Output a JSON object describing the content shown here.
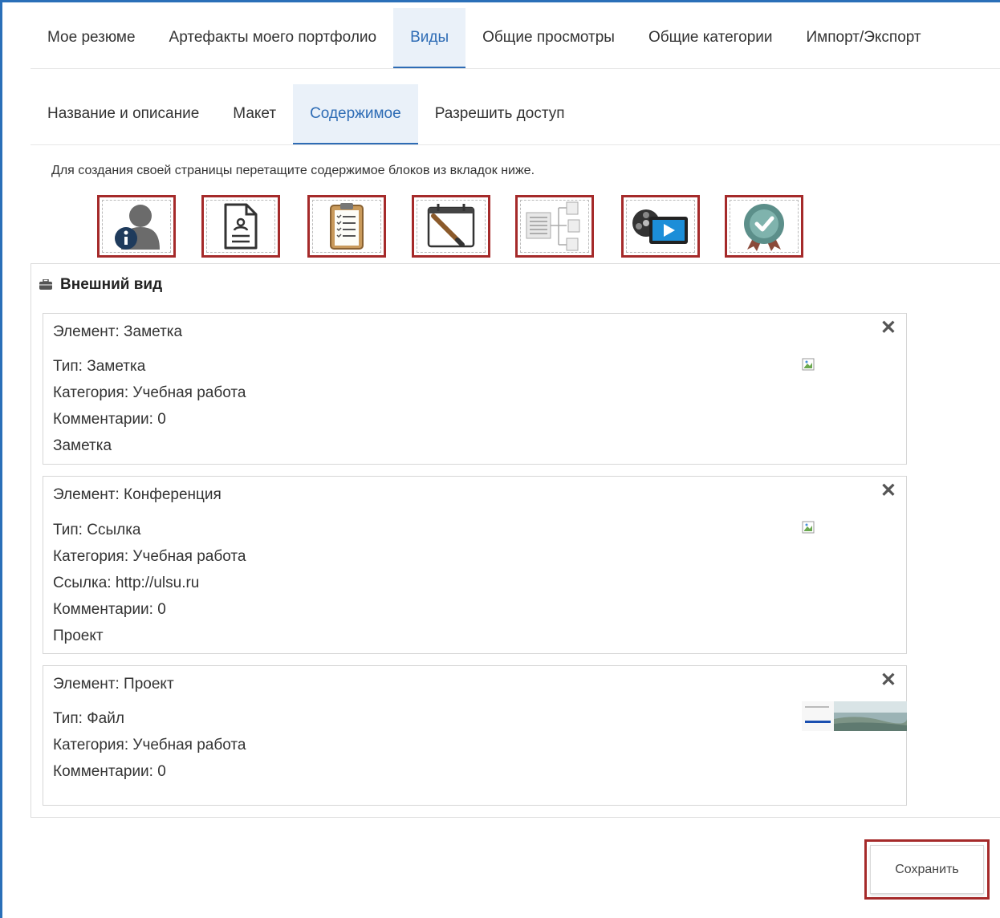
{
  "main_tabs": [
    {
      "label": "Мое резюме",
      "active": false
    },
    {
      "label": "Артефакты моего портфолио",
      "active": false
    },
    {
      "label": "Виды",
      "active": true
    },
    {
      "label": "Общие просмотры",
      "active": false
    },
    {
      "label": "Общие категории",
      "active": false
    },
    {
      "label": "Импорт/Экспорт",
      "active": false
    }
  ],
  "sub_tabs": [
    {
      "label": "Название и описание",
      "active": false
    },
    {
      "label": "Макет",
      "active": false
    },
    {
      "label": "Содержимое",
      "active": true
    },
    {
      "label": "Разрешить доступ",
      "active": false
    }
  ],
  "hint": "Для создания своей страницы перетащите содержимое блоков из вкладок ниже.",
  "block_icons": [
    "profile-info-icon",
    "resume-document-icon",
    "clipboard-checklist-icon",
    "calendar-pen-icon",
    "diagram-tree-icon",
    "video-film-icon",
    "certificate-badge-icon"
  ],
  "section": {
    "title": "Внешний вид",
    "icon": "briefcase-icon",
    "cards": [
      {
        "title": "Элемент: Заметка",
        "lines": [
          "Тип: Заметка",
          "Категория: Учебная работа",
          "Комментарии: 0",
          "Заметка"
        ],
        "image": "broken-image-icon"
      },
      {
        "title": "Элемент: Конференция",
        "lines": [
          "Тип: Ссылка",
          "Категория: Учебная работа",
          "Ссылка: http://ulsu.ru",
          "Комментарии: 0",
          "Проект"
        ],
        "image": "broken-image-icon"
      },
      {
        "title": "Элемент: Проект",
        "lines": [
          "Тип: Файл",
          "Категория: Учебная работа",
          "Комментарии: 0"
        ],
        "image": "file-thumbnail"
      }
    ]
  },
  "save_label": "Сохранить",
  "colors": {
    "accent": "#2e6cb5",
    "highlight_border": "#a52a2a",
    "frame": "#2a6fb8"
  }
}
